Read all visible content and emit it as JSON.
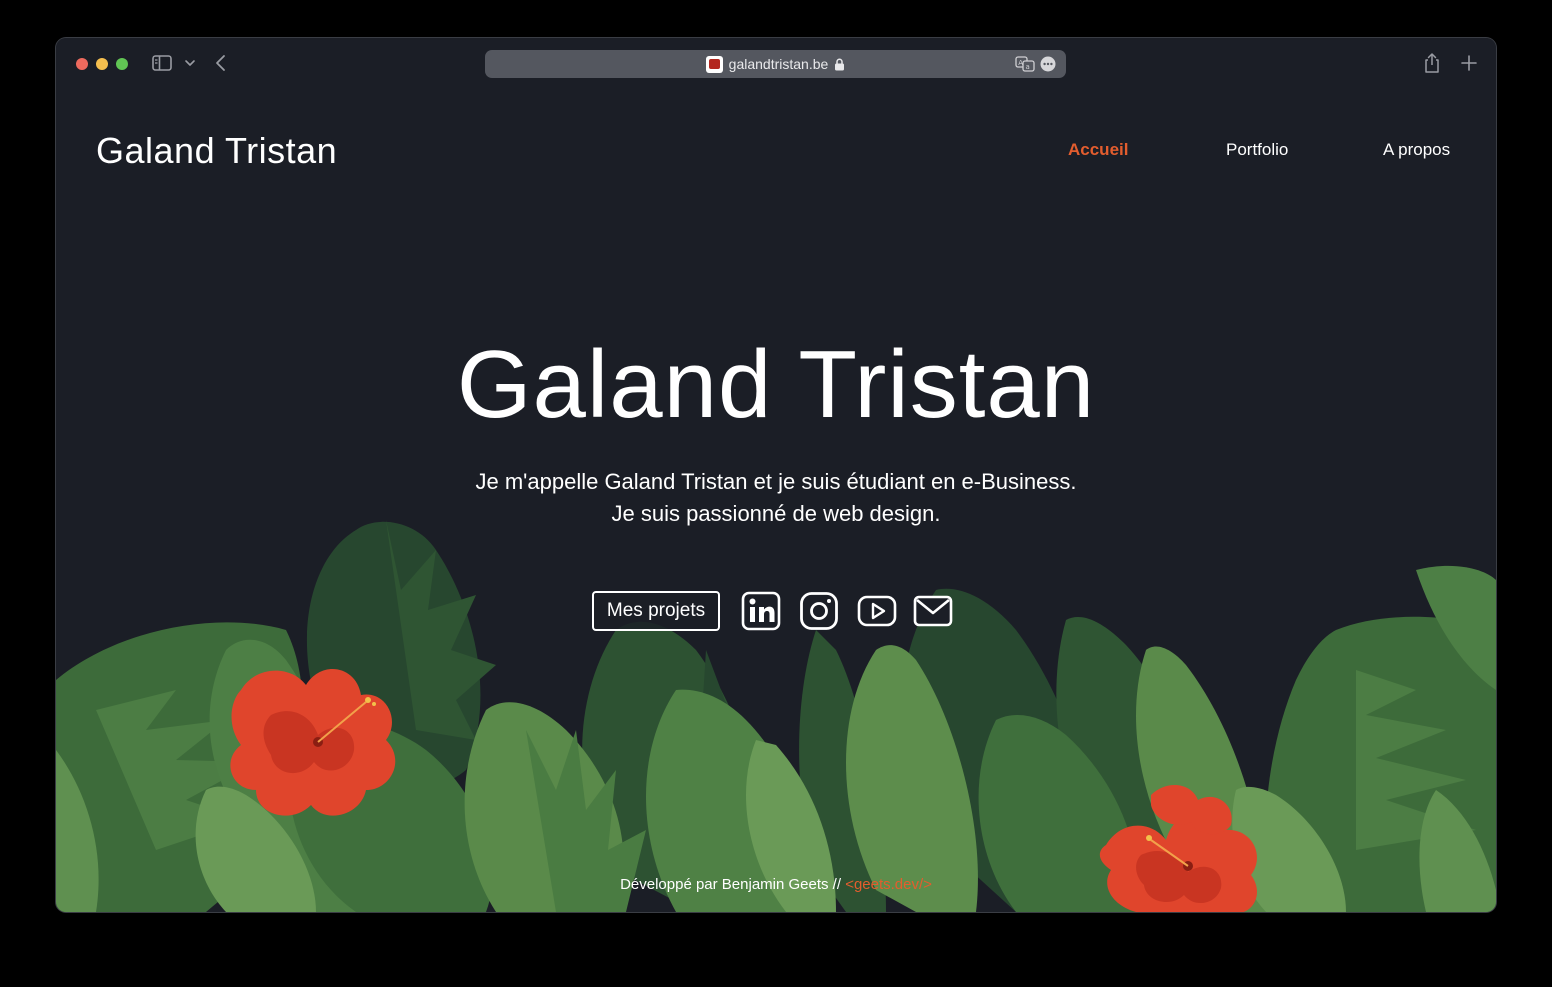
{
  "browser": {
    "url": "galandtristan.be",
    "icons": [
      "sidebar-icon",
      "chevron-down-icon",
      "back-icon",
      "favicon",
      "lock-icon",
      "translate-icon",
      "more-icon",
      "share-icon",
      "plus-icon"
    ]
  },
  "site": {
    "brand": "Galand Tristan",
    "nav": {
      "home": "Accueil",
      "portfolio": "Portfolio",
      "about": "A propos"
    },
    "hero": {
      "title": "Galand Tristan",
      "line1": "Je m'appelle Galand Tristan et je suis étudiant en e-Business.",
      "line2": "Je suis passionné de web design."
    },
    "projects_button": "Mes projets",
    "social_icons": [
      "linkedin-icon",
      "instagram-icon",
      "youtube-icon",
      "mail-icon"
    ],
    "footer": {
      "text": "Développé par Benjamin Geets // ",
      "link": "<geets.dev/>"
    }
  },
  "colors": {
    "background": "#1b1e26",
    "accent": "#e35d2e",
    "text": "#ffffff",
    "leaf_dark": "#27472f",
    "leaf_mid": "#3d6b3a",
    "leaf_light": "#5a8a4a",
    "flower": "#e0452c"
  }
}
